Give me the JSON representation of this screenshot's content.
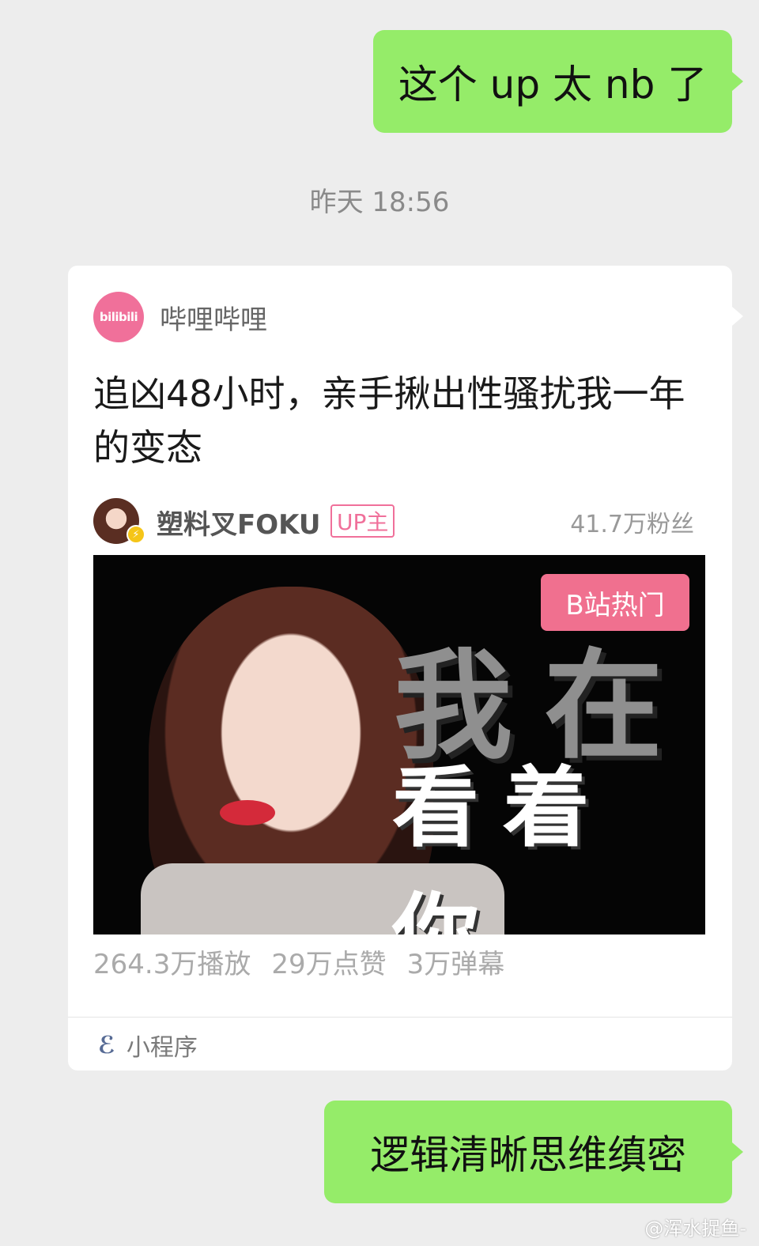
{
  "messages": {
    "msg1": "这个 up 太 nb 了",
    "msg3": "逻辑清晰思维缜密"
  },
  "timestamp": "昨天 18:56",
  "card": {
    "app_logo_text": "bilibili",
    "app_name": "哔哩哔哩",
    "title": "追凶48小时，亲手揪出性骚扰我一年的变态",
    "uploader_name": "塑料叉FOKU",
    "uploader_tag": "UP主",
    "followers": "41.7万粉丝",
    "thumbnail": {
      "hot_badge": "B站热门",
      "overlay_line1": "我在",
      "overlay_line2": "看着你"
    },
    "stats": {
      "plays": "264.3万播放",
      "likes": "29万点赞",
      "danmaku": "3万弹幕"
    },
    "footer_icon": "mini-program-icon",
    "footer_label": "小程序"
  },
  "watermark": "@浑水捉鱼-",
  "colors": {
    "chat_bg": "#ededed",
    "bubble_green": "#95ec69",
    "bilibili_pink": "#f0709a",
    "link_blue": "#576b95"
  }
}
